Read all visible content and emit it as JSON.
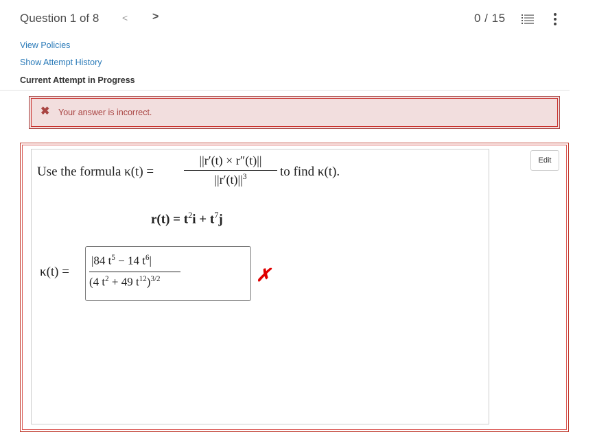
{
  "header": {
    "question_label": "Question 1 of 8",
    "prev_glyph": "<",
    "next_glyph": ">",
    "score": "0 / 15"
  },
  "policies": {
    "view_policies": "View Policies",
    "show_history": "Show Attempt History",
    "current_attempt": "Current Attempt in Progress"
  },
  "feedback": {
    "icon": "x-icon",
    "message": "Your answer is incorrect."
  },
  "question": {
    "edit_label": "Edit",
    "prompt_before": "Use the formula κ(t) =",
    "formula_numerator": "||r′(t) × r″(t)||",
    "formula_denominator": "||r′(t)||",
    "formula_den_power": "3",
    "prompt_after": "to find κ(t).",
    "r_definition_lhs": "r(t) = t",
    "r_definition_exp1": "2",
    "r_definition_mid": "i + t",
    "r_definition_exp2": "7",
    "r_definition_end": "j"
  },
  "answer": {
    "label": "κ(t) =",
    "numerator_text": "|84 t",
    "numerator_exp1": "5",
    "numerator_mid": " − 14 t",
    "numerator_exp2": "6",
    "numerator_end": "|",
    "denominator_text": "(4 t",
    "denominator_exp1": "2",
    "denominator_mid": " + 49 t",
    "denominator_exp2": "12",
    "denominator_close": ")",
    "denominator_power": "3/2",
    "result_mark": "✗",
    "status": "incorrect"
  },
  "colors": {
    "error_bg": "#f2dede",
    "error_text": "#a94442",
    "link": "#2a7ab8",
    "wrong_mark": "#e00000"
  }
}
